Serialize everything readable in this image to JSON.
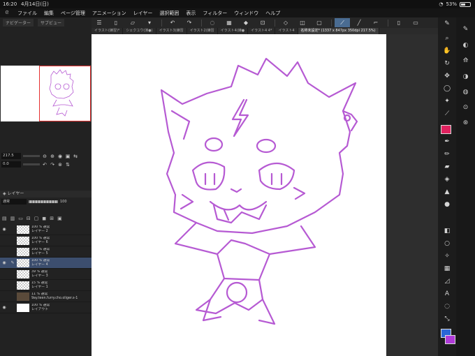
{
  "status_bar": {
    "time": "16:20",
    "date": "4月14日(日)",
    "battery": "53%",
    "battery_level": 0.53
  },
  "menu": {
    "items": [
      "ファイル",
      "編集",
      "ページ管理",
      "アニメーション",
      "レイヤー",
      "選択範囲",
      "表示",
      "フィルター",
      "ウィンドウ",
      "ヘルプ"
    ]
  },
  "command_bar": {
    "icons": [
      "menu-icon",
      "new-file-icon",
      "open-file-icon",
      "save-icon",
      "undo-icon",
      "redo-icon",
      "transform-icon",
      "ruler-active-icon",
      "pen-pressure-icon",
      "smartphone-icon"
    ]
  },
  "tabs": [
    "イラスト(練習)*",
    "シェクユウ(演●)",
    "イラスト3(練習",
    "イラスト2(練習",
    "イラスト4(練●",
    "イラスト4 4*",
    "イラスト4",
    "名称未設定* (1337 x 847px 350dpi 217.5%)"
  ],
  "navigator": {
    "tab_navigator": "ナビゲーター",
    "tab_sub": "サブビュー",
    "zoom": "217.5",
    "rotation": "0.0"
  },
  "layers": {
    "header": "レイヤー",
    "blend_mode": "通常",
    "opacity": "100",
    "rows": [
      {
        "line1": "100 % 通常",
        "line2": "レイヤー 2",
        "visible": true
      },
      {
        "line1": "100 % 通常",
        "line2": "レイヤー 6",
        "visible": false
      },
      {
        "line1": "100 % 通常",
        "line2": "レイヤー 5",
        "visible": false
      },
      {
        "line1": "100 % 通常",
        "line2": "レイヤー 4",
        "visible": true,
        "selected": true
      },
      {
        "line1": "39 % 通常",
        "line2": "レイヤー 3",
        "visible": false
      },
      {
        "line1": "15 % 通常",
        "line2": "レイヤー 1",
        "visible": false
      },
      {
        "line1": "11 % 通常",
        "line2": "9ay.teen.furry.cho.oliger.s-1",
        "visible": false,
        "photo": true
      },
      {
        "line1": "100 % 通常",
        "line2": "レイアウト",
        "visible": true,
        "white": true
      }
    ]
  },
  "colors": {
    "stroke": "#b65ad3",
    "main_color": "#e0225f",
    "fg": "#2a66d6",
    "bg": "#b03ad8",
    "selected_layer": "#3c4e6e"
  },
  "tools": [
    "pen-settings-icon",
    "zoom-icon",
    "hand-icon",
    "rotate-icon",
    "move-icon",
    "lasso-icon",
    "magic-wand-icon",
    "eyedropper-icon",
    "pen-icon",
    "pencil-icon",
    "eraser-icon",
    "fill-icon",
    "blend-icon",
    "gradient-icon",
    "ellipse-icon",
    "sparkle-icon",
    "frame-icon",
    "ruler-icon",
    "text-icon",
    "balloon-icon",
    "line-tool-icon"
  ]
}
